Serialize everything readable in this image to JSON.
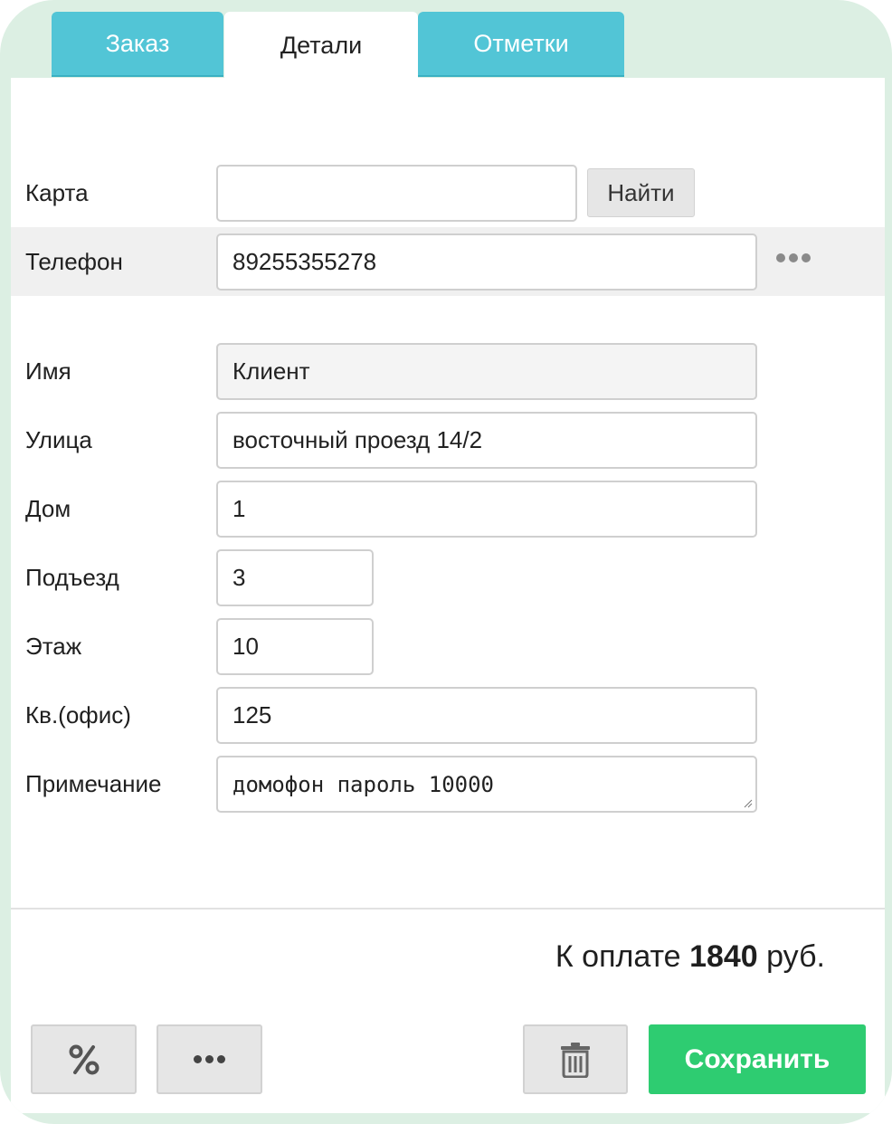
{
  "tabs": [
    {
      "label": "Заказ",
      "active": false
    },
    {
      "label": "Детали",
      "active": true
    },
    {
      "label": "Отметки",
      "active": false
    }
  ],
  "form": {
    "card": {
      "label": "Карта",
      "value": ""
    },
    "find_button": "Найти",
    "phone": {
      "label": "Телефон",
      "value": "89255355278"
    },
    "name": {
      "label": "Имя",
      "value": "Клиент"
    },
    "street": {
      "label": "Улица",
      "value": "восточный проезд 14/2"
    },
    "house": {
      "label": "Дом",
      "value": "1"
    },
    "entrance": {
      "label": "Подъезд",
      "value": "3"
    },
    "floor": {
      "label": "Этаж",
      "value": "10"
    },
    "apartment": {
      "label": "Кв.(офис)",
      "value": "125"
    },
    "note": {
      "label": "Примечание",
      "value": "домофон пароль 10000"
    }
  },
  "total": {
    "prefix": "К оплате",
    "amount": "1840",
    "currency": "руб."
  },
  "actions": {
    "discount_icon": "percent-icon",
    "more_icon": "more-dots-icon",
    "delete_icon": "trash-icon",
    "save_label": "Сохранить"
  },
  "colors": {
    "tab_inactive": "#52c5d6",
    "save_button": "#2ecc71",
    "frame_background": "#dcefe3"
  }
}
